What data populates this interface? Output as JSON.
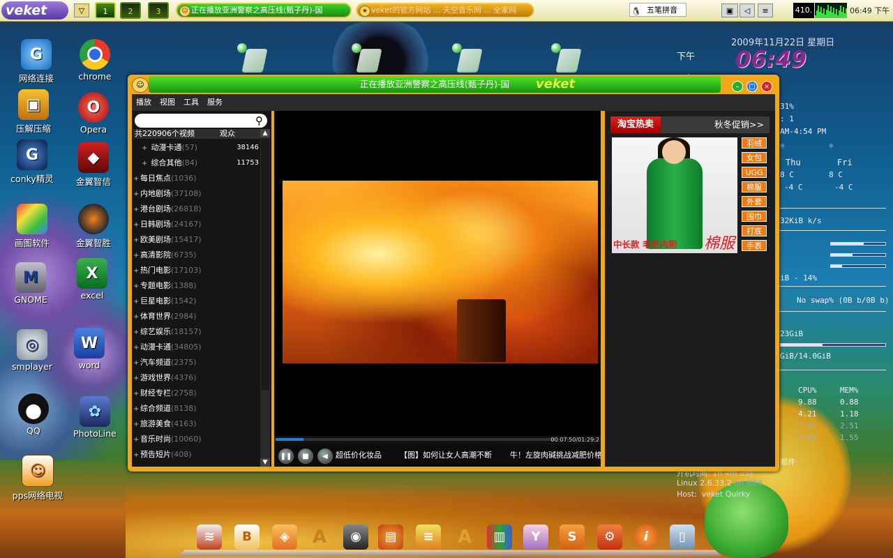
{
  "top_panel": {
    "logo": "veket",
    "workspaces": [
      "1",
      "2",
      "3"
    ],
    "active_workspace": 0,
    "tasks": [
      {
        "label": "正在播放亚洲警察之高压线(甄子丹)-国",
        "active": true
      },
      {
        "label": "veket的官方网站 ... 天空音乐网 ... 全家网",
        "active": false
      }
    ],
    "ime_label": "五笔拼音",
    "cpu_value": "410.",
    "clock": "06:49 下午"
  },
  "conky": {
    "date": "2009年11月22日  星期日",
    "time": "06:49",
    "ampm": "下午",
    "ampm2": "下午",
    "cpu_pct": "31%",
    "colon_one": ": 1",
    "time_am": "AM-4:54 PM",
    "days": [
      "Thu",
      "Fri"
    ],
    "temp_hi": [
      "8 C",
      "8 C"
    ],
    "temp_lo": [
      "-4 C",
      "-4 C"
    ],
    "net": "32KiB k/s",
    "ram": "iB - 14%",
    "swap": "No swap% (0B  b/0B  b)",
    "disk1": "23GiB",
    "disk2": "GiB/14.0GiB",
    "proc_head": [
      "CPU%",
      "MEM%"
    ],
    "proc_rows": [
      [
        "9.88",
        "0.88"
      ],
      [
        "4.21",
        "1.18"
      ],
      [
        "1.66",
        "2.51"
      ],
      [
        "0.88",
        "1.55"
      ]
    ],
    "uptime": "开机时间:    1h 4m 35s",
    "mail": "邮件",
    "kernel_prefix": "Linux 2.6.33.2",
    "kernel_arch": "on i686",
    "host_label": "Host:",
    "host": "veket Quirky"
  },
  "desktop_icons": [
    {
      "label": "网络连接"
    },
    {
      "label": "chrome"
    },
    {
      "label": "压解压缩"
    },
    {
      "label": "Opera"
    },
    {
      "label": "conky精灵"
    },
    {
      "label": "金翼智信"
    },
    {
      "label": "画图软件"
    },
    {
      "label": "金翼智胜"
    },
    {
      "label": "GNOME"
    },
    {
      "label": "excel"
    },
    {
      "label": "smplayer"
    },
    {
      "label": "word"
    },
    {
      "label": "QQ"
    },
    {
      "label": "PhotoLine"
    },
    {
      "label": "pps网络电视"
    }
  ],
  "window": {
    "title": "正在播放亚洲警察之高压线(甄子丹)-国",
    "brand": "veket",
    "menu": [
      "播放",
      "视图",
      "工具",
      "服务"
    ],
    "list_header": {
      "total": "共220906个视频",
      "views": "观众"
    },
    "sub_items": [
      {
        "name": "动漫卡通",
        "count": "(57)",
        "views": "38146"
      },
      {
        "name": "综合其他",
        "count": "(84)",
        "views": "11753"
      }
    ],
    "categories": [
      {
        "name": "每日焦点",
        "count": "(1036)"
      },
      {
        "name": "内地剧场",
        "count": "(37108)"
      },
      {
        "name": "港台剧场",
        "count": "(26818)"
      },
      {
        "name": "日韩剧场",
        "count": "(24167)"
      },
      {
        "name": "欧美剧场",
        "count": "(15417)"
      },
      {
        "name": "高清影院",
        "count": "(6735)"
      },
      {
        "name": "热门电影",
        "count": "(17103)"
      },
      {
        "name": "专题电影",
        "count": "(1388)"
      },
      {
        "name": "巨星电影",
        "count": "(1542)"
      },
      {
        "name": "体育世界",
        "count": "(2984)"
      },
      {
        "name": "综艺娱乐",
        "count": "(18157)"
      },
      {
        "name": "动漫卡通",
        "count": "(34805)"
      },
      {
        "name": "汽车频道",
        "count": "(2375)"
      },
      {
        "name": "游戏世界",
        "count": "(4376)"
      },
      {
        "name": "财经专栏",
        "count": "(2758)"
      },
      {
        "name": "综合频道",
        "count": "(8138)"
      },
      {
        "name": "旅游美食",
        "count": "(4163)"
      },
      {
        "name": "音乐时尚",
        "count": "(10060)"
      },
      {
        "name": "预告短片",
        "count": "(408)"
      }
    ],
    "playback": {
      "progress": 0.1,
      "time": "00:07:50/01:29:2"
    },
    "ticker": [
      "超低价化妆品",
      "【图】如何让女人高潮不断",
      "牛！左旋肉碱挑战减肥价格"
    ],
    "ad": {
      "brand": "淘宝热卖",
      "promo": "秋冬促销>>",
      "caption1": "中长款 毛毛内胆",
      "caption2": "棉服",
      "tags": [
        "羽绒",
        "女包",
        "UGG",
        "棉服",
        "外套",
        "围巾",
        "打底",
        "手表"
      ]
    }
  }
}
